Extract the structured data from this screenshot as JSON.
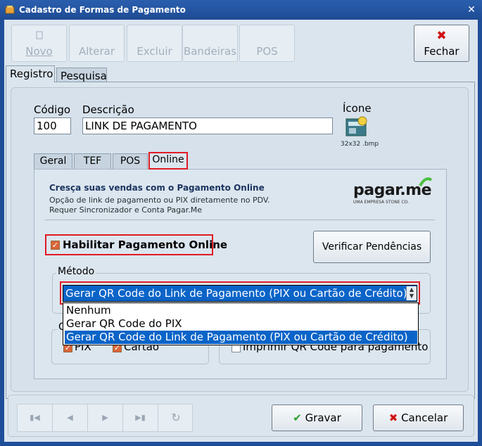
{
  "window": {
    "title": "Cadastro de Formas de Pagamento",
    "close_glyph": "✕"
  },
  "toolbar": {
    "novo": "Novo",
    "alterar": "Alterar",
    "excluir": "Excluir",
    "bandeiras": "Bandeiras",
    "pos": "POS",
    "fechar": "Fechar",
    "fechar_icon": "close-icon",
    "fechar_glyph": "✖"
  },
  "tabs": {
    "registro": "Registro",
    "pesquisa": "Pesquisa"
  },
  "form": {
    "codigo_label": "Código",
    "codigo_value": "100",
    "descricao_label": "Descrição",
    "descricao_value": "LINK DE PAGAMENTO",
    "icone_label": "Ícone",
    "icone_caption": "32x32 .bmp"
  },
  "subtabs": [
    "Geral",
    "TEF",
    "POS",
    "Online"
  ],
  "online": {
    "headline": "Cresça suas vendas com o Pagamento Online",
    "desc1": "Opção de link de pagamento ou PIX diretamente no PDV.",
    "desc2": "Requer Sincronizador e Conta Pagar.Me",
    "logo_text": "pagar.me",
    "logo_sub": "UMA EMPRESA STONE CO.",
    "habilitar_label": "Habilitar Pagamento Online",
    "habilitar_checked": true,
    "verificar_label": "Verificar Pendências",
    "metodo_label": "Método",
    "metodo_selected": "Gerar QR Code do Link de Pagamento (PIX ou Cartão de Crédito)",
    "metodo_options": [
      "Nenhum",
      "Gerar QR Code do PIX",
      "Gerar QR Code do Link de Pagamento (PIX ou Cartão de Crédito)"
    ],
    "group2_label_partial": "C",
    "pix_label": "PIX",
    "cartao_label": "Cartão",
    "imprimir_label": "Imprimir QR Code para pagamento"
  },
  "bottom": {
    "gravar": "Gravar",
    "cancelar": "Cancelar",
    "refresh_glyph": "↻"
  },
  "colors": {
    "accent": "#1f4e99",
    "selection": "#0a64c8",
    "highlight": "#e01b24",
    "check": "#d9663a"
  }
}
